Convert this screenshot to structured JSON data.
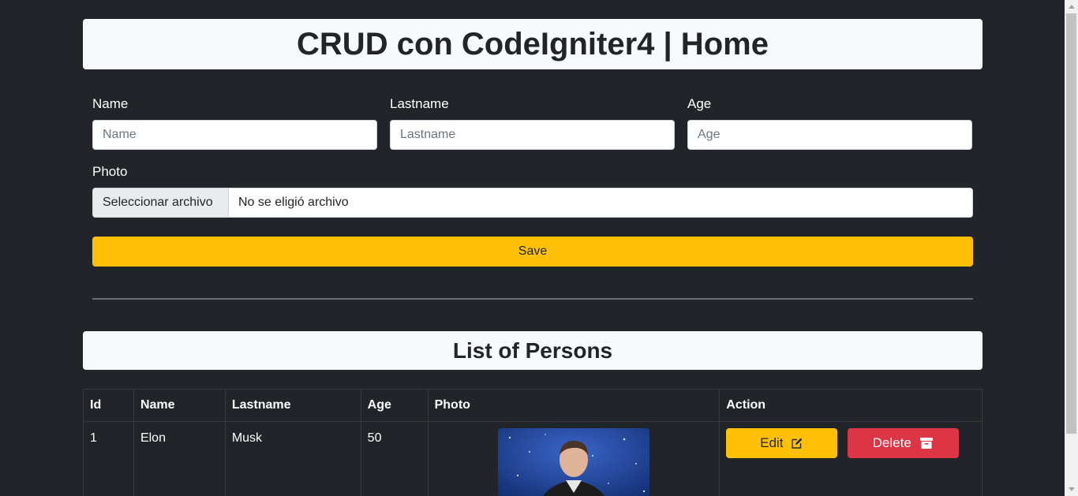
{
  "header": {
    "title": "CRUD con CodeIgniter4 | Home"
  },
  "form": {
    "name": {
      "label": "Name",
      "placeholder": "Name",
      "value": ""
    },
    "lastname": {
      "label": "Lastname",
      "placeholder": "Lastname",
      "value": ""
    },
    "age": {
      "label": "Age",
      "placeholder": "Age",
      "value": ""
    },
    "photo": {
      "label": "Photo",
      "button": "Seleccionar archivo",
      "status": "No se eligió archivo"
    },
    "save_label": "Save"
  },
  "list": {
    "title": "List of Persons",
    "columns": [
      "Id",
      "Name",
      "Lastname",
      "Age",
      "Photo",
      "Action"
    ],
    "rows": [
      {
        "id": "1",
        "name": "Elon",
        "lastname": "Musk",
        "age": "50",
        "edit_label": "Edit",
        "delete_label": "Delete"
      }
    ]
  },
  "icons": {
    "edit": "pencil-square-icon",
    "delete": "archive-icon"
  },
  "colors": {
    "background": "#212529",
    "warning": "#ffc107",
    "danger": "#dc3545",
    "light": "#f8f9fa"
  }
}
